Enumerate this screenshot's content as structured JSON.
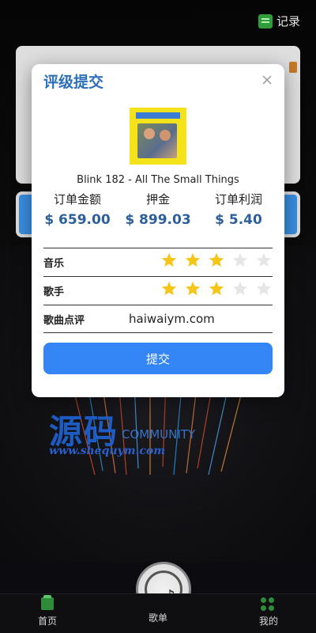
{
  "app": {
    "top_action_label": "记录"
  },
  "watermark": {
    "brand": "源码",
    "sub": "COMMUNITY",
    "url": "www.shequym.com"
  },
  "modal": {
    "title": "评级提交",
    "song": "Blink 182 - All The Small Things",
    "stats": [
      {
        "label": "订单金额",
        "value": "$ 659.00"
      },
      {
        "label": "押金",
        "value": "$ 899.03"
      },
      {
        "label": "订单利润",
        "value": "$ 5.40"
      }
    ],
    "music_label": "音乐",
    "music_rating": 3,
    "singer_label": "歌手",
    "singer_rating": 3,
    "rating_max": 5,
    "comment_label": "歌曲点评",
    "comment_value": "haiwaiym.com",
    "submit_label": "提交"
  },
  "nav": {
    "home_label": "首页",
    "playlist_label": "歌单",
    "mine_label": "我的"
  },
  "colors": {
    "accent": "#3485f5",
    "title": "#2d6fb8",
    "value": "#2d5f9a",
    "star_on": "#f5c518",
    "star_off": "#e6e6e6",
    "nav_green": "#2e8b3a"
  }
}
